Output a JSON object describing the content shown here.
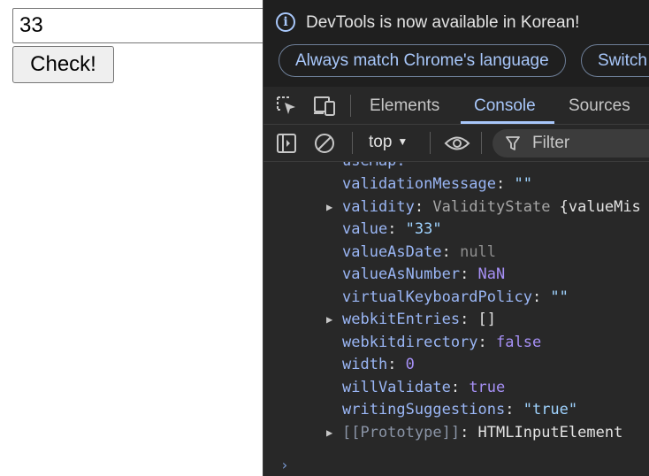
{
  "page": {
    "input_value": "33",
    "check_label": "Check!"
  },
  "devtools": {
    "infobar": {
      "message": "DevTools is now available in Korean!",
      "match_language_label": "Always match Chrome's language",
      "switch_label": "Switch"
    },
    "tabs": [
      {
        "label": "Elements",
        "active": false
      },
      {
        "label": "Console",
        "active": true
      },
      {
        "label": "Sources",
        "active": false
      }
    ],
    "toolbar": {
      "context": "top",
      "filter_placeholder": "Filter"
    },
    "console": {
      "partial_top": "useMap:",
      "lines": [
        {
          "key": "validationMessage",
          "value": "\"\"",
          "type": "string",
          "expandable": false
        },
        {
          "key": "validity",
          "value": "ValidityState {valueMis",
          "type": "object",
          "expandable": true
        },
        {
          "key": "value",
          "value": "\"33\"",
          "type": "string",
          "expandable": false
        },
        {
          "key": "valueAsDate",
          "value": "null",
          "type": "null",
          "expandable": false
        },
        {
          "key": "valueAsNumber",
          "value": "NaN",
          "type": "number",
          "expandable": false
        },
        {
          "key": "virtualKeyboardPolicy",
          "value": "\"\"",
          "type": "string",
          "expandable": false
        },
        {
          "key": "webkitEntries",
          "value": "[]",
          "type": "plain",
          "expandable": true
        },
        {
          "key": "webkitdirectory",
          "value": "false",
          "type": "number",
          "expandable": false
        },
        {
          "key": "width",
          "value": "0",
          "type": "number",
          "expandable": false
        },
        {
          "key": "willValidate",
          "value": "true",
          "type": "number",
          "expandable": false
        },
        {
          "key": "writingSuggestions",
          "value": "\"true\"",
          "type": "string",
          "expandable": false
        },
        {
          "key": "[[Prototype]]",
          "value": "HTMLInputElement",
          "type": "plain",
          "expandable": true,
          "dim": true
        }
      ],
      "prompt": "›"
    }
  },
  "colors": {
    "devtools_bg": "#282828",
    "accent": "#a8c7fa",
    "key": "#9ab6f5",
    "string": "#9fd3ff",
    "number": "#a690f5"
  },
  "icons": [
    "info-icon",
    "inspect-element-icon",
    "device-toolbar-icon",
    "sidebar-toggle-icon",
    "clear-console-icon",
    "eye-icon",
    "filter-icon",
    "caret-down-icon",
    "expand-triangle-icon"
  ]
}
